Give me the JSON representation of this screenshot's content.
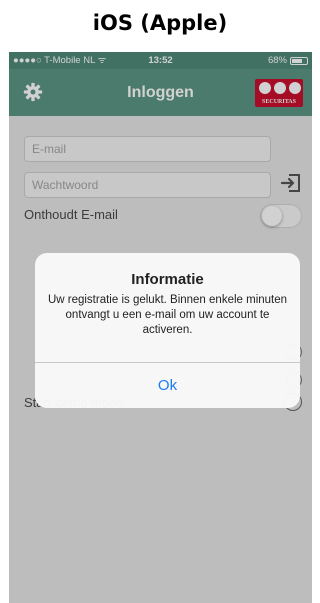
{
  "caption": "iOS (Apple)",
  "statusbar": {
    "carrier": "●●●●○ T-Mobile NL ᯤ",
    "time": "13:52",
    "battery": "68%"
  },
  "navbar": {
    "title": "Inloggen",
    "gear_icon": "gear-icon",
    "logo_text": "SECURITAS"
  },
  "form": {
    "email_placeholder": "E-mail",
    "password_placeholder": "Wachtwoord",
    "remember_label": "Onthoudt E-mail",
    "demo_label": "Start demo mode",
    "info_icon_glyph": "i",
    "remember_toggle_on": false
  },
  "alert": {
    "title": "Informatie",
    "message": "Uw registratie is gelukt. Binnen enkele minuten ontvangt u een e-mail om uw account te activeren.",
    "ok_label": "Ok"
  },
  "colors": {
    "header": "#5c9684",
    "statusbar": "#4f8a78",
    "brand_logo": "#c8102e",
    "alert_button": "#1a7cf5"
  }
}
